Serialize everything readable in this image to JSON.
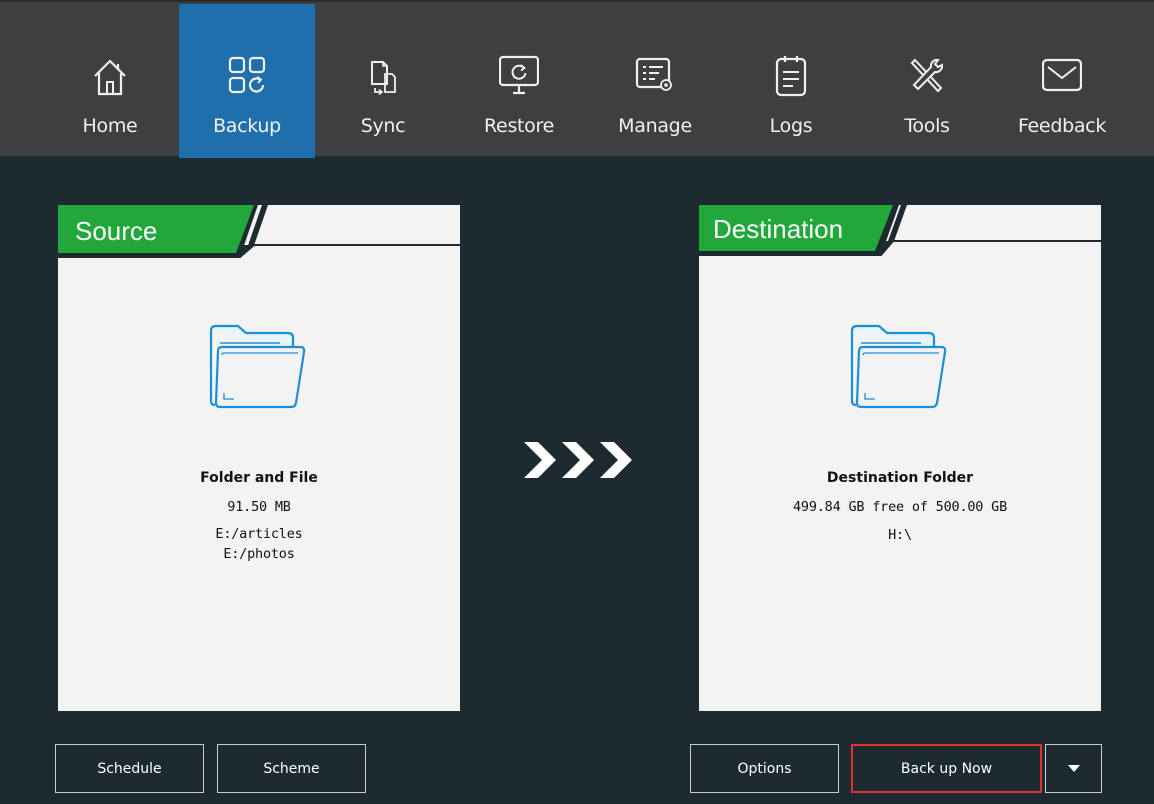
{
  "nav": {
    "items": [
      {
        "label": "Home",
        "icon": "home-icon",
        "active": false
      },
      {
        "label": "Backup",
        "icon": "backup-icon",
        "active": true
      },
      {
        "label": "Sync",
        "icon": "sync-icon",
        "active": false
      },
      {
        "label": "Restore",
        "icon": "restore-icon",
        "active": false
      },
      {
        "label": "Manage",
        "icon": "manage-icon",
        "active": false
      },
      {
        "label": "Logs",
        "icon": "logs-icon",
        "active": false
      },
      {
        "label": "Tools",
        "icon": "tools-icon",
        "active": false
      },
      {
        "label": "Feedback",
        "icon": "feedback-icon",
        "active": false
      }
    ]
  },
  "source": {
    "title": "Source",
    "name": "Folder and File",
    "size": "91.50 MB",
    "paths": [
      "E:/articles",
      "E:/photos"
    ]
  },
  "destination": {
    "title": "Destination",
    "name": "Destination Folder",
    "space": "499.84 GB free of 500.00 GB",
    "path": "H:\\"
  },
  "buttons": {
    "schedule": "Schedule",
    "scheme": "Scheme",
    "options": "Options",
    "backup_now": "Back up Now"
  },
  "colors": {
    "background": "#1d2b31",
    "topbar": "#3d3f41",
    "active_tab": "#1f6fad",
    "header_green": "#22a83a",
    "folder_blue": "#1a8fd6",
    "highlight_red": "#e03030"
  }
}
